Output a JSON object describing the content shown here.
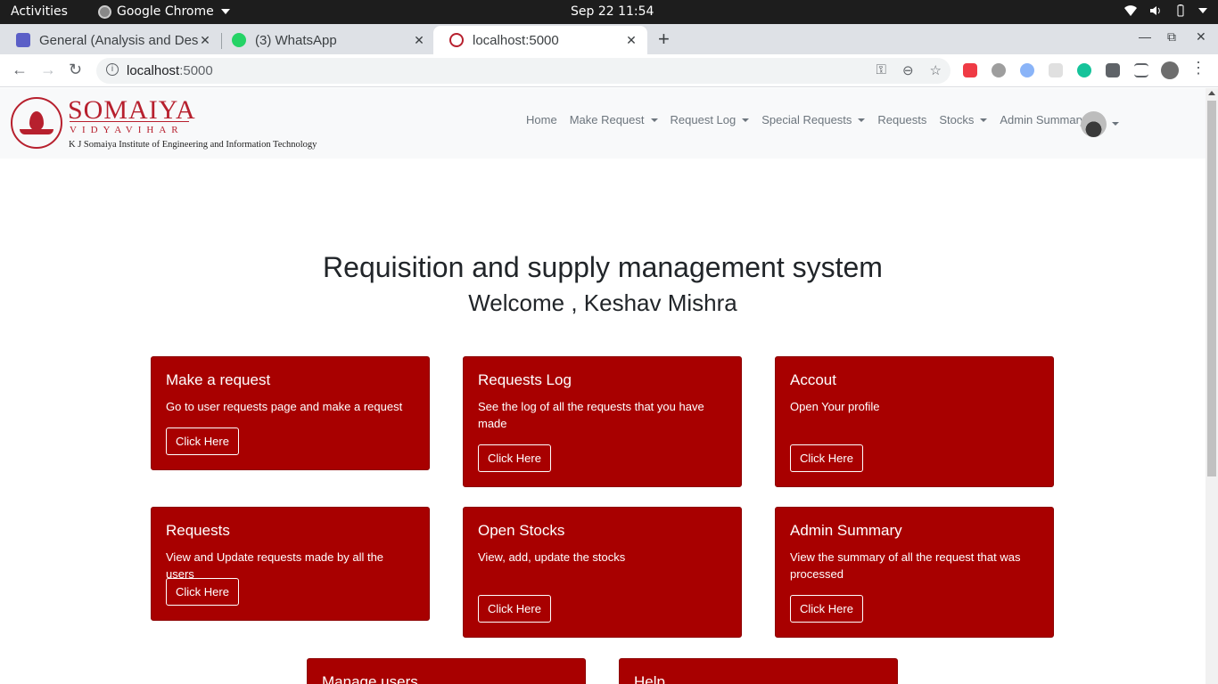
{
  "os": {
    "activities": "Activities",
    "app_name": "Google Chrome",
    "clock": "Sep 22  11:54"
  },
  "browser": {
    "tabs": [
      {
        "title": "General (Analysis and Des",
        "favicon_color": "#5b5fc7"
      },
      {
        "title": "(3) WhatsApp",
        "favicon_color": "#25d366",
        "badge": "3"
      },
      {
        "title": "localhost:5000",
        "favicon_color": "#b7202e"
      }
    ],
    "new_tab": "+",
    "url_host": "localhost",
    "url_port": ":5000"
  },
  "site": {
    "brand": "SOMAIYA",
    "brand_sub": "VIDYAVIHAR",
    "institute": "K J Somaiya Institute of Engineering and Information Technology",
    "nav": [
      {
        "label": "Home",
        "dropdown": false
      },
      {
        "label": "Make Request",
        "dropdown": true
      },
      {
        "label": "Request Log",
        "dropdown": true
      },
      {
        "label": "Special Requests",
        "dropdown": true
      },
      {
        "label": "Requests",
        "dropdown": false
      },
      {
        "label": "Stocks",
        "dropdown": true
      },
      {
        "label": "Admin Summary",
        "dropdown": false
      }
    ]
  },
  "main": {
    "title": "Requisition and supply management system",
    "welcome": "Welcome , Keshav Mishra",
    "cards": [
      {
        "title": "Make a request",
        "desc": "Go to user requests page and make a request",
        "button": "Click Here"
      },
      {
        "title": "Requests Log",
        "desc": "See the log of all the requests that you have made",
        "button": "Click Here"
      },
      {
        "title": "Accout",
        "desc": "Open Your profile",
        "button": "Click Here"
      },
      {
        "title": "Requests",
        "desc": "View and Update requests made by all the users",
        "button": "Click Here"
      },
      {
        "title": "Open Stocks",
        "desc": "View, add, update the stocks",
        "button": "Click Here"
      },
      {
        "title": "Admin Summary",
        "desc": "View the summary of all the request that was processed",
        "button": "Click Here"
      },
      {
        "title": "Manage users",
        "desc": "",
        "button": ""
      },
      {
        "title": "Help",
        "desc": "",
        "button": ""
      }
    ]
  },
  "colors": {
    "card": "#a80000",
    "brand": "#b7202e"
  }
}
